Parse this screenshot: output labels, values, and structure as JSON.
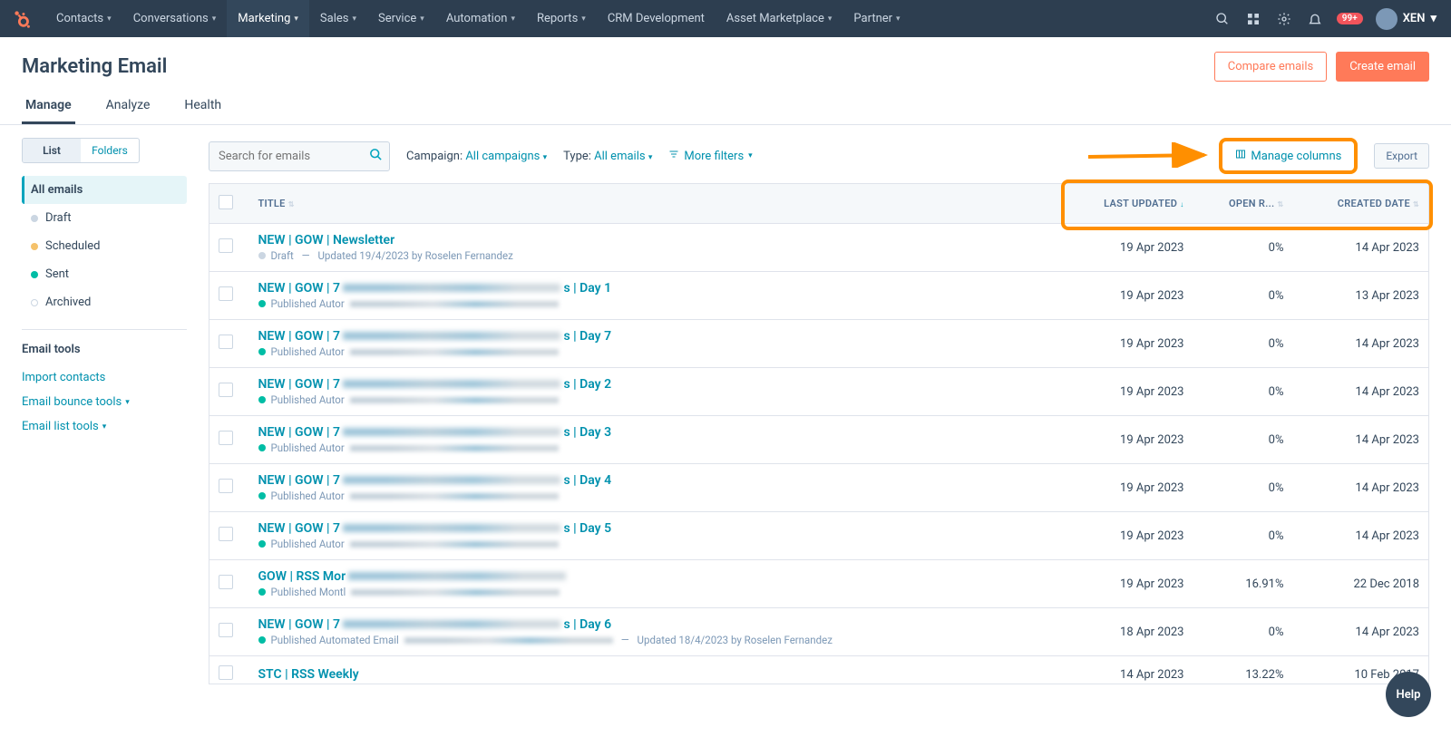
{
  "topnav": {
    "menu": [
      {
        "label": "Contacts",
        "chev": true
      },
      {
        "label": "Conversations",
        "chev": true
      },
      {
        "label": "Marketing",
        "chev": true,
        "active": true
      },
      {
        "label": "Sales",
        "chev": true
      },
      {
        "label": "Service",
        "chev": true
      },
      {
        "label": "Automation",
        "chev": true
      },
      {
        "label": "Reports",
        "chev": true
      },
      {
        "label": "CRM Development",
        "chev": false
      },
      {
        "label": "Asset Marketplace",
        "chev": true
      },
      {
        "label": "Partner",
        "chev": true
      }
    ],
    "notif_badge": "99+",
    "account": "XEN"
  },
  "page": {
    "title": "Marketing Email"
  },
  "header_actions": {
    "compare": "Compare emails",
    "create": "Create email"
  },
  "tabs": [
    "Manage",
    "Analyze",
    "Health"
  ],
  "active_tab": "Manage",
  "left": {
    "toggle": [
      "List",
      "Folders"
    ],
    "toggle_active": "List",
    "filters": [
      {
        "label": "All emails",
        "dot": "",
        "active": true
      },
      {
        "label": "Draft",
        "dot": "gray"
      },
      {
        "label": "Scheduled",
        "dot": "yellow"
      },
      {
        "label": "Sent",
        "dot": "green"
      },
      {
        "label": "Archived",
        "dot": "ring"
      }
    ],
    "tools_title": "Email tools",
    "tools": [
      {
        "label": "Import contacts",
        "chev": false
      },
      {
        "label": "Email bounce tools",
        "chev": true
      },
      {
        "label": "Email list tools",
        "chev": true
      }
    ]
  },
  "toolbar": {
    "search_placeholder": "Search for emails",
    "campaign_label": "Campaign:",
    "campaign_value": "All campaigns",
    "type_label": "Type:",
    "type_value": "All emails",
    "more_filters": "More filters",
    "manage_columns": "Manage columns",
    "export": "Export"
  },
  "columns": {
    "title": "TITLE",
    "last_updated": "LAST UPDATED",
    "open_rate": "OPEN R...",
    "created": "CREATED DATE"
  },
  "rows": [
    {
      "title": "NEW | GOW | Newsletter",
      "title_suffix": "",
      "status": "Draft",
      "status_dot": "gray",
      "sub": "Updated 19/4/2023 by Roselen Fernandez",
      "blur": false,
      "last": "19 Apr 2023",
      "open": "0%",
      "created": "14 Apr 2023"
    },
    {
      "title": "NEW | GOW | 7",
      "title_suffix": "s | Day 1",
      "status": "Published Autor",
      "status_dot": "green",
      "sub": "",
      "blur": true,
      "last": "19 Apr 2023",
      "open": "0%",
      "created": "13 Apr 2023"
    },
    {
      "title": "NEW | GOW | 7",
      "title_suffix": "s | Day 7",
      "status": "Published Autor",
      "status_dot": "green",
      "sub": "",
      "blur": true,
      "last": "19 Apr 2023",
      "open": "0%",
      "created": "14 Apr 2023"
    },
    {
      "title": "NEW | GOW | 7",
      "title_suffix": "s | Day 2",
      "status": "Published Autor",
      "status_dot": "green",
      "sub": "",
      "blur": true,
      "last": "19 Apr 2023",
      "open": "0%",
      "created": "14 Apr 2023"
    },
    {
      "title": "NEW | GOW | 7",
      "title_suffix": "s | Day 3",
      "status": "Published Autor",
      "status_dot": "green",
      "sub": "",
      "blur": true,
      "last": "19 Apr 2023",
      "open": "0%",
      "created": "14 Apr 2023"
    },
    {
      "title": "NEW | GOW | 7",
      "title_suffix": "s | Day 4",
      "status": "Published Autor",
      "status_dot": "green",
      "sub": "",
      "blur": true,
      "last": "19 Apr 2023",
      "open": "0%",
      "created": "14 Apr 2023"
    },
    {
      "title": "NEW | GOW | 7",
      "title_suffix": "s | Day 5",
      "status": "Published Autor",
      "status_dot": "green",
      "sub": "",
      "blur": true,
      "last": "19 Apr 2023",
      "open": "0%",
      "created": "14 Apr 2023"
    },
    {
      "title": "GOW | RSS Mor",
      "title_suffix": "",
      "status": "Published Montl",
      "status_dot": "green",
      "sub": "",
      "blur": true,
      "last": "19 Apr 2023",
      "open": "16.91%",
      "created": "22 Dec 2018"
    },
    {
      "title": "NEW | GOW | 7",
      "title_suffix": "s | Day 6",
      "status": "Published Automated Email",
      "status_dot": "green",
      "sub": "Updated 18/4/2023 by Roselen Fernandez",
      "blur": true,
      "last": "18 Apr 2023",
      "open": "0%",
      "created": "14 Apr 2023"
    },
    {
      "title": "STC | RSS Weekly",
      "title_suffix": "",
      "status": "",
      "status_dot": "",
      "sub": "",
      "blur": false,
      "last": "14 Apr 2023",
      "open": "13.22%",
      "created": "10 Feb 2017"
    }
  ],
  "help": "Help"
}
